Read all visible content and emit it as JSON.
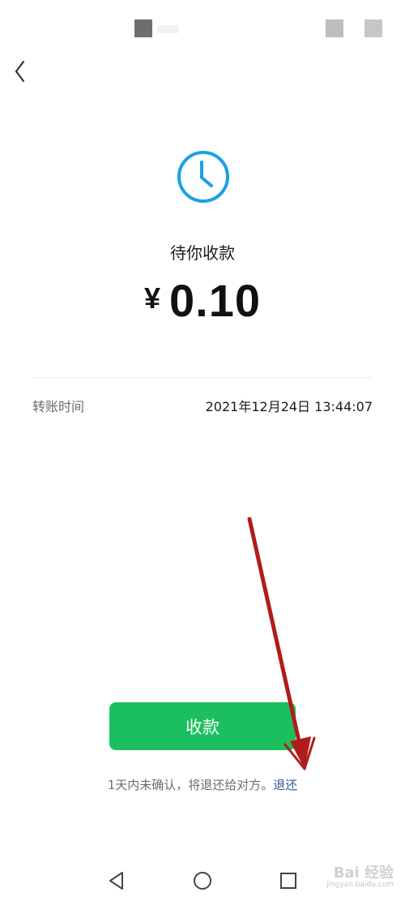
{
  "header": {
    "back_icon": "chevron-left-icon"
  },
  "status": {
    "icon": "clock-icon",
    "accent_color": "#1aa1e6",
    "label": "待你收款"
  },
  "amount": {
    "currency": "¥",
    "value": "0.10"
  },
  "details": {
    "transfer_time_label": "转账时间",
    "transfer_time_value": "2021年12月24日 13:44:07"
  },
  "actions": {
    "receive_label": "收款",
    "receive_color": "#1cbf5e"
  },
  "note": {
    "text": "1天内未确认，将退还给对方。",
    "refund_link": "退还",
    "link_color": "#2f5a9a"
  },
  "annotation": {
    "arrow_color": "#b01c1c"
  },
  "nav": {
    "back_icon": "triangle-back-icon",
    "home_icon": "circle-home-icon",
    "recent_icon": "square-recent-icon"
  },
  "watermark": {
    "brand": "Bai 经验",
    "url": "jingyan.baidu.com"
  }
}
